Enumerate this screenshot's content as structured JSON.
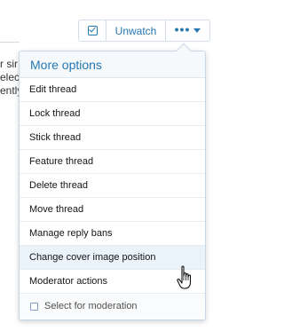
{
  "background": {
    "lines": [
      "r sir",
      "elect",
      "ently",
      ""
    ]
  },
  "toolbar": {
    "watch_check": "check-icon",
    "unwatch_label": "Unwatch",
    "more_label": "•••"
  },
  "menu": {
    "title": "More options",
    "items": [
      {
        "label": "Edit thread"
      },
      {
        "label": "Lock thread"
      },
      {
        "label": "Stick thread"
      },
      {
        "label": "Feature thread"
      },
      {
        "label": "Delete thread"
      },
      {
        "label": "Move thread"
      },
      {
        "label": "Manage reply bans"
      },
      {
        "label": "Change cover image position"
      },
      {
        "label": "Moderator actions"
      }
    ],
    "footer_label": "Select for moderation"
  },
  "colors": {
    "accent": "#2577b1",
    "hover_row": "#eaf2fa",
    "header_bg": "#f5f9fc"
  }
}
